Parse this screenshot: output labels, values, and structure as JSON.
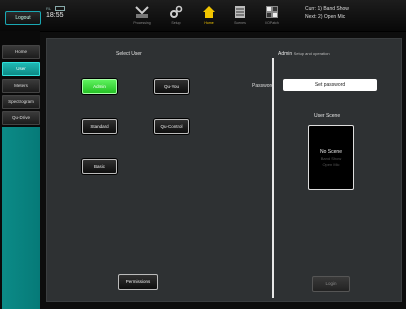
{
  "topbar": {
    "logout_label": "Logout",
    "status_small": "RL",
    "time": "18:55",
    "tabs": [
      {
        "label": "Processing",
        "icon": "processing-icon"
      },
      {
        "label": "Setup",
        "icon": "setup-icon"
      },
      {
        "label": "Home",
        "icon": "home-icon"
      },
      {
        "label": "Scenes",
        "icon": "scenes-icon"
      },
      {
        "label": "I/OPatch",
        "icon": "patch-icon"
      }
    ],
    "active_tab": "Home",
    "current_scene": "Curr: 1) Band Show",
    "next_scene": "Next: 2) Open Mic"
  },
  "sidebar": {
    "items": [
      {
        "label": "Home"
      },
      {
        "label": "User"
      },
      {
        "label": "Meters"
      },
      {
        "label": "Spectrogram"
      },
      {
        "label": "Qu-Drive"
      }
    ],
    "active": "User"
  },
  "select_user": {
    "title": "Select User",
    "users": [
      {
        "label": "Admin"
      },
      {
        "label": "Qu-You"
      },
      {
        "label": "Standard"
      },
      {
        "label": "Qu-Control"
      },
      {
        "label": "Basic"
      }
    ],
    "selected": "Admin",
    "permissions_label": "Permissions"
  },
  "admin": {
    "title": "Admin",
    "subtitle": "Setup and operation",
    "password_label": "Password",
    "password_button": "Set password",
    "user_scene_title": "User Scene",
    "scene_current": "No Scene",
    "scene_option_1": "Band Show",
    "scene_option_2": "Open Mic",
    "login_label": "Login"
  },
  "colors": {
    "accent": "#1fb8b3",
    "selected_user": "#3ddc3d",
    "active_tab": "#f2c500"
  }
}
